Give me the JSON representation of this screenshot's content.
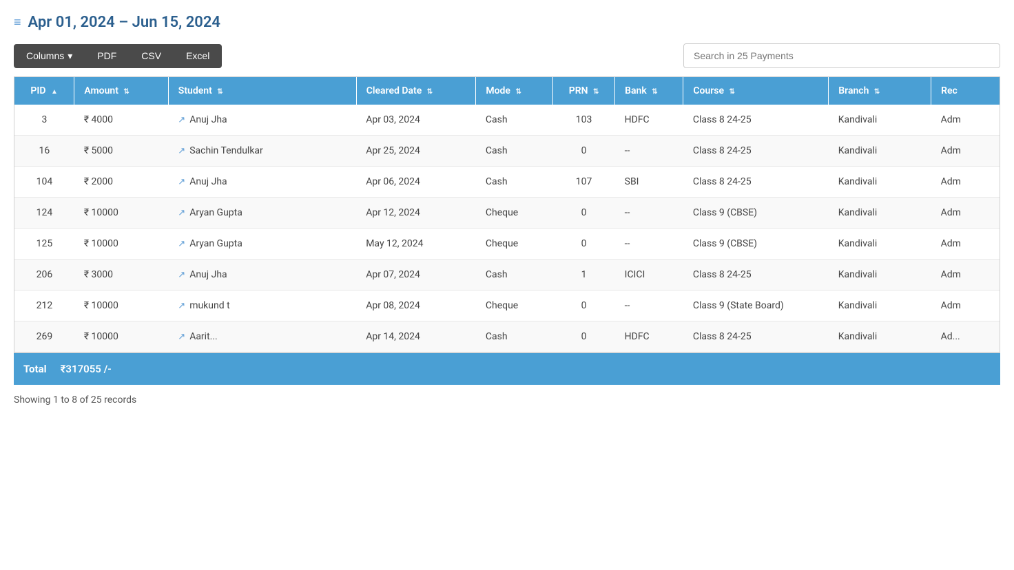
{
  "header": {
    "filter_icon": "≡",
    "date_range": "Apr 01, 2024 – Jun 15, 2024"
  },
  "toolbar": {
    "columns_label": "Columns",
    "columns_arrow": "▾",
    "pdf_label": "PDF",
    "csv_label": "CSV",
    "excel_label": "Excel",
    "search_placeholder": "Search in 25 Payments"
  },
  "table": {
    "columns": [
      {
        "key": "pid",
        "label": "PID",
        "sort": "▲"
      },
      {
        "key": "amount",
        "label": "Amount",
        "sort": "⇅"
      },
      {
        "key": "student",
        "label": "Student",
        "sort": "⇅"
      },
      {
        "key": "cleared_date",
        "label": "Cleared Date",
        "sort": "⇅"
      },
      {
        "key": "mode",
        "label": "Mode",
        "sort": "⇅"
      },
      {
        "key": "prn",
        "label": "PRN",
        "sort": "⇅"
      },
      {
        "key": "bank",
        "label": "Bank",
        "sort": "⇅"
      },
      {
        "key": "course",
        "label": "Course",
        "sort": "⇅"
      },
      {
        "key": "branch",
        "label": "Branch",
        "sort": "⇅"
      },
      {
        "key": "rec",
        "label": "Rec",
        "sort": ""
      }
    ],
    "rows": [
      {
        "pid": "3",
        "amount": "₹ 4000",
        "student": "Anuj Jha",
        "cleared_date": "Apr 03, 2024",
        "mode": "Cash",
        "prn": "103",
        "bank": "HDFC",
        "course": "Class 8 24-25",
        "branch": "Kandivali",
        "rec": "Adm"
      },
      {
        "pid": "16",
        "amount": "₹ 5000",
        "student": "Sachin Tendulkar",
        "cleared_date": "Apr 25, 2024",
        "mode": "Cash",
        "prn": "0",
        "bank": "--",
        "course": "Class 8 24-25",
        "branch": "Kandivali",
        "rec": "Adm"
      },
      {
        "pid": "104",
        "amount": "₹ 2000",
        "student": "Anuj Jha",
        "cleared_date": "Apr 06, 2024",
        "mode": "Cash",
        "prn": "107",
        "bank": "SBI",
        "course": "Class 8 24-25",
        "branch": "Kandivali",
        "rec": "Adm"
      },
      {
        "pid": "124",
        "amount": "₹ 10000",
        "student": "Aryan Gupta",
        "cleared_date": "Apr 12, 2024",
        "mode": "Cheque",
        "prn": "0",
        "bank": "--",
        "course": "Class 9 (CBSE)",
        "branch": "Kandivali",
        "rec": "Adm"
      },
      {
        "pid": "125",
        "amount": "₹ 10000",
        "student": "Aryan Gupta",
        "cleared_date": "May 12, 2024",
        "mode": "Cheque",
        "prn": "0",
        "bank": "--",
        "course": "Class 9 (CBSE)",
        "branch": "Kandivali",
        "rec": "Adm"
      },
      {
        "pid": "206",
        "amount": "₹ 3000",
        "student": "Anuj Jha",
        "cleared_date": "Apr 07, 2024",
        "mode": "Cash",
        "prn": "1",
        "bank": "ICICI",
        "course": "Class 8 24-25",
        "branch": "Kandivali",
        "rec": "Adm"
      },
      {
        "pid": "212",
        "amount": "₹ 10000",
        "student": "mukund t",
        "cleared_date": "Apr 08, 2024",
        "mode": "Cheque",
        "prn": "0",
        "bank": "--",
        "course": "Class 9 (State Board)",
        "branch": "Kandivali",
        "rec": "Adm"
      },
      {
        "pid": "269",
        "amount": "₹ 10000",
        "student": "Aarit...",
        "cleared_date": "Apr 14, 2024",
        "mode": "Cash",
        "prn": "0",
        "bank": "HDFC",
        "course": "Class 8 24-25",
        "branch": "Kandivali",
        "rec": "Ad..."
      }
    ]
  },
  "footer": {
    "total_label": "Total",
    "total_amount": "₹317055 /-",
    "pagination": "Showing 1 to 8 of 25 records"
  }
}
